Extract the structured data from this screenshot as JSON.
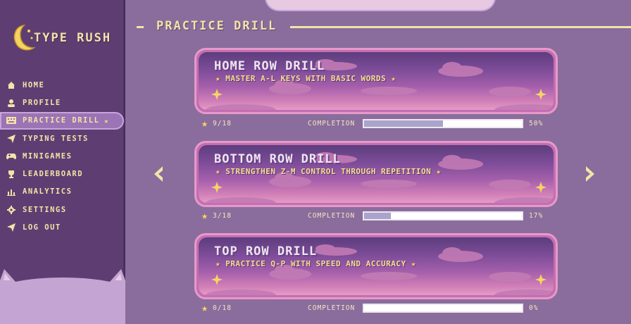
{
  "app": {
    "name": "TYPE RUSH"
  },
  "colors": {
    "accent": "#f4e3a8",
    "sidebar": "#5e3e72",
    "background": "#8a6d9c",
    "card_border": "#e69ac9",
    "progress": "#a9a4cc"
  },
  "sidebar": {
    "items": [
      {
        "label": "HOME",
        "icon": "home-icon"
      },
      {
        "label": "PROFILE",
        "icon": "user-icon"
      },
      {
        "label": "PRACTICE DRILL",
        "icon": "keyboard-icon",
        "active": true
      },
      {
        "label": "TYPING TESTS",
        "icon": "send-icon"
      },
      {
        "label": "MINIGAMES",
        "icon": "gamepad-icon"
      },
      {
        "label": "LEADERBOARD",
        "icon": "trophy-icon"
      },
      {
        "label": "ANALYTICS",
        "icon": "chart-icon"
      },
      {
        "label": "SETTINGS",
        "icon": "gear-icon"
      },
      {
        "label": "LOG OUT",
        "icon": "logout-icon"
      }
    ]
  },
  "page": {
    "title": "PRACTICE DRILL"
  },
  "drills": [
    {
      "title": "HOME ROW DRILL",
      "description": "MASTER A-L KEYS WITH BASIC WORDS",
      "score": "9/18",
      "completion_label": "COMPLETION",
      "percent_text": "50%",
      "progress": 0.5
    },
    {
      "title": "BOTTOM ROW DRILL",
      "description": "STRENGTHEN Z-M CONTROL THROUGH REPETITION",
      "score": "3/18",
      "completion_label": "COMPLETION",
      "percent_text": "17%",
      "progress": 0.17
    },
    {
      "title": "TOP ROW DRILL",
      "description": "PRACTICE Q-P WITH SPEED AND ACCURACY",
      "score": "0/18",
      "completion_label": "COMPLETION",
      "percent_text": "0%",
      "progress": 0
    }
  ]
}
